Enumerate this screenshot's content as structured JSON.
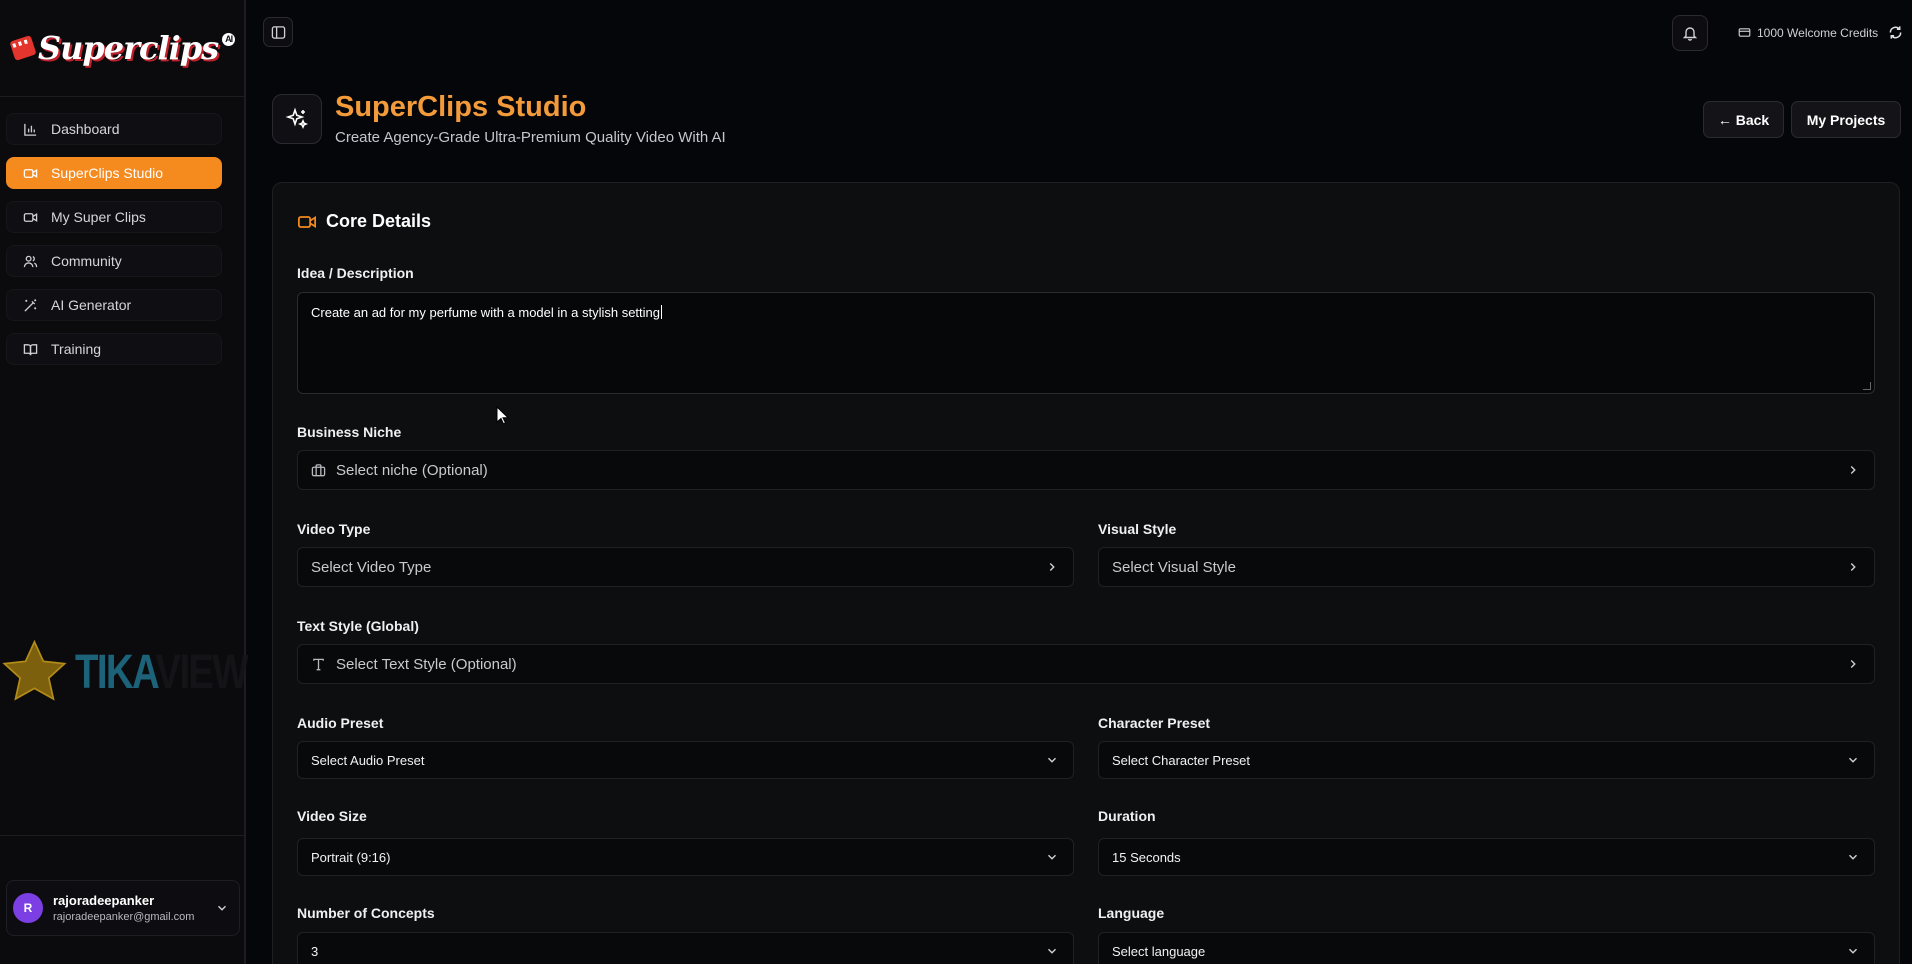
{
  "sidebar": {
    "logo_text": "Superclips",
    "logo_badge": "AI",
    "items": [
      {
        "label": "Dashboard",
        "icon": "bar-chart-icon"
      },
      {
        "label": "SuperClips Studio",
        "icon": "video-icon"
      },
      {
        "label": "My Super Clips",
        "icon": "video-icon"
      },
      {
        "label": "Community",
        "icon": "users-icon"
      },
      {
        "label": "AI Generator",
        "icon": "magic-wand-icon"
      },
      {
        "label": "Training",
        "icon": "book-icon"
      }
    ],
    "active_item": "SuperClips Studio",
    "user": {
      "initial": "R",
      "name": "rajoradeepanker",
      "email": "rajoradeepanker@gmail.com"
    }
  },
  "watermark": {
    "text_a": "TIKA",
    "text_b": "VIEW"
  },
  "topbar": {
    "credits": "1000 Welcome Credits"
  },
  "header": {
    "title": "SuperClips Studio",
    "subtitle": "Create Agency-Grade Ultra-Premium Quality Video With AI",
    "back_label": "← Back",
    "projects_label": "My Projects"
  },
  "form": {
    "section_title": "Core Details",
    "idea": {
      "label": "Idea / Description",
      "value": "Create an ad for my perfume with a model in a stylish setting"
    },
    "niche": {
      "label": "Business Niche",
      "placeholder": "Select niche (Optional)"
    },
    "video_type": {
      "label": "Video Type",
      "placeholder": "Select Video Type"
    },
    "visual_style": {
      "label": "Visual Style",
      "placeholder": "Select Visual Style"
    },
    "text_style": {
      "label": "Text Style (Global)",
      "placeholder": "Select Text Style (Optional)"
    },
    "audio_preset": {
      "label": "Audio Preset",
      "value": "Select Audio Preset"
    },
    "character_preset": {
      "label": "Character Preset",
      "value": "Select Character Preset"
    },
    "video_size": {
      "label": "Video Size",
      "value": "Portrait (9:16)"
    },
    "duration": {
      "label": "Duration",
      "value": "15 Seconds"
    },
    "concepts": {
      "label": "Number of Concepts",
      "value": "3"
    },
    "language": {
      "label": "Language",
      "value": "Select language"
    }
  },
  "colors": {
    "accent": "#f58a1f",
    "title": "#f39a3a",
    "avatar": "#7b3fe4"
  }
}
